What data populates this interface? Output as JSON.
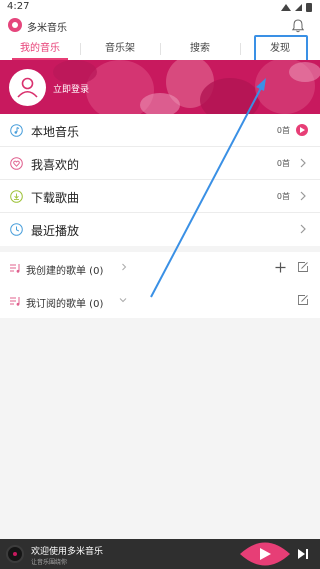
{
  "status_bar": {
    "time": "4:27"
  },
  "header": {
    "app_title": "多米音乐",
    "bell_icon": "bell-icon"
  },
  "tabs": [
    {
      "label": "我的音乐",
      "active": true
    },
    {
      "label": "音乐架",
      "active": false
    },
    {
      "label": "搜索",
      "active": false
    },
    {
      "label": "发现",
      "active": false,
      "highlighted": true
    }
  ],
  "banner": {
    "login_label": "立即登录",
    "avatar_icon": "user-icon"
  },
  "menu": [
    {
      "label": "本地音乐",
      "icon": "music-note-icon",
      "count": "0首",
      "action": "play-icon"
    },
    {
      "label": "我喜欢的",
      "icon": "heart-icon",
      "count": "0首",
      "action": "chevron-right-icon"
    },
    {
      "label": "下载歌曲",
      "icon": "download-icon",
      "count": "0首",
      "action": "chevron-right-icon"
    },
    {
      "label": "最近播放",
      "icon": "clock-icon",
      "count": "",
      "action": "chevron-right-icon"
    }
  ],
  "playlists": [
    {
      "label": "我创建的歌单 (0)",
      "caret": "chevron-right-icon",
      "actions": [
        "add-icon",
        "edit-icon"
      ]
    },
    {
      "label": "我订阅的歌单 (0)",
      "caret": "chevron-down-icon",
      "actions": [
        "edit-icon"
      ]
    }
  ],
  "player": {
    "title": "欢迎使用多米音乐",
    "subtitle": "让音乐围绕你",
    "play_icon": "play-icon",
    "next_icon": "next-track-icon"
  },
  "colors": {
    "accent": "#e73e76",
    "banner": "#c8195e",
    "highlight_box": "#3a90e5",
    "arrow": "#3a90e5",
    "player_bg": "#2f2f2f"
  }
}
